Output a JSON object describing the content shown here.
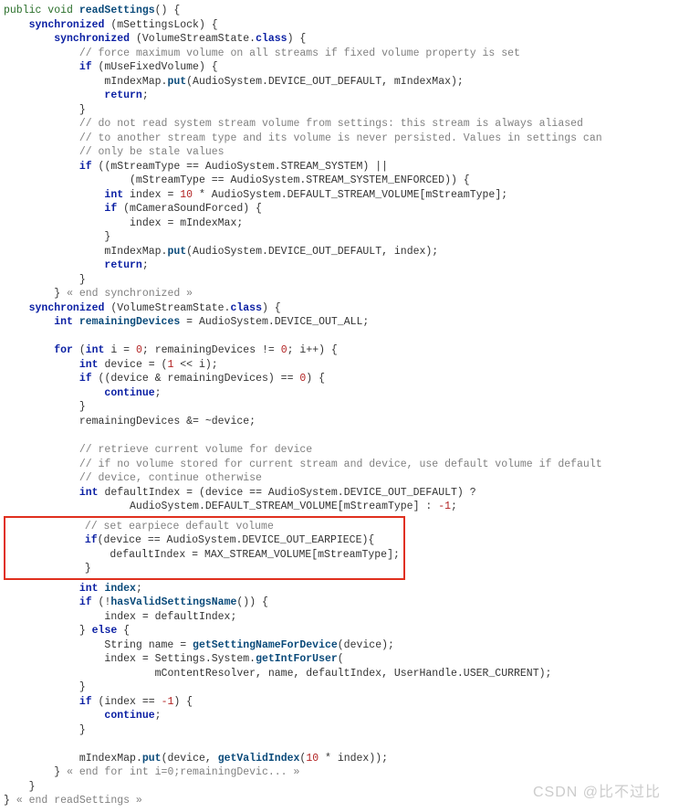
{
  "code": {
    "l1_a": "public void ",
    "l1_b": "readSettings",
    "l1_c": "() {",
    "l2_a": "synchronized",
    "l2_b": " (mSettingsLock) {",
    "l3_a": "synchronized",
    "l3_b": " (VolumeStreamState.",
    "l3_c": "class",
    "l3_d": ") {",
    "l4": "// force maximum volume on all streams if fixed volume property is set",
    "l5_a": "if",
    "l5_b": " (mUseFixedVolume) {",
    "l6_a": "mIndexMap.",
    "l6_b": "put",
    "l6_c": "(AudioSystem.DEVICE_OUT_DEFAULT, mIndexMax);",
    "l7": "return",
    "l7_b": ";",
    "l8": "}",
    "l9": "// do not read system stream volume from settings: this stream is always aliased",
    "l10": "// to another stream type and its volume is never persisted. Values in settings can",
    "l11": "// only be stale values",
    "l12_a": "if",
    "l12_b": " ((mStreamType == AudioSystem.STREAM_SYSTEM) ||",
    "l13": "(mStreamType == AudioSystem.STREAM_SYSTEM_ENFORCED)) {",
    "l14_a": "int",
    "l14_b": " index = ",
    "l14_c": "10",
    "l14_d": " * AudioSystem.DEFAULT_STREAM_VOLUME[mStreamType];",
    "l15_a": "if",
    "l15_b": " (mCameraSoundForced) {",
    "l16": "index = mIndexMax;",
    "l17": "}",
    "l18_a": "mIndexMap.",
    "l18_b": "put",
    "l18_c": "(AudioSystem.DEVICE_OUT_DEFAULT, index);",
    "l19": "return",
    "l19_b": ";",
    "l20": "}",
    "l21": "}",
    "l21_b": " « end synchronized »",
    "l22_a": "synchronized",
    "l22_b": " (VolumeStreamState.",
    "l22_c": "class",
    "l22_d": ") {",
    "l23_a": "int",
    "l23_b": " ",
    "l23_c": "remainingDevices",
    "l23_d": " = AudioSystem.DEVICE_OUT_ALL;",
    "l24_a": "for",
    "l24_b": " (",
    "l24_c": "int",
    "l24_d": " i = ",
    "l24_e": "0",
    "l24_f": "; remainingDevices != ",
    "l24_g": "0",
    "l24_h": "; i++) {",
    "l25_a": "int",
    "l25_b": " device = (",
    "l25_c": "1",
    "l25_d": " << i);",
    "l26_a": "if",
    "l26_b": " ((device & remainingDevices) == ",
    "l26_c": "0",
    "l26_d": ") {",
    "l27": "continue",
    "l27_b": ";",
    "l28": "}",
    "l29": "remainingDevices &= ~device;",
    "l30": "// retrieve current volume for device",
    "l31": "// if no volume stored for current stream and device, use default volume if default",
    "l32": "// device, continue otherwise",
    "l33_a": "int",
    "l33_b": " defaultIndex = (device == AudioSystem.DEVICE_OUT_DEFAULT) ?",
    "l34_a": "AudioSystem.DEFAULT_STREAM_VOLUME[mStreamType] : ",
    "l34_b": "-1",
    "l34_c": ";",
    "box_l1": "// set earpiece default volume",
    "box_l2_a": "if",
    "box_l2_b": "(device == AudioSystem.DEVICE_OUT_EARPIECE){",
    "box_l3": "defaultIndex = MAX_STREAM_VOLUME[mStreamType];",
    "box_l4": "}",
    "l35_a": "int",
    "l35_b": " ",
    "l35_c": "index",
    "l35_d": ";",
    "l36_a": "if",
    "l36_b": " (!",
    "l36_c": "hasValidSettingsName",
    "l36_d": "()) {",
    "l37": "index = defaultIndex;",
    "l38_a": "} ",
    "l38_b": "else",
    "l38_c": " {",
    "l39_a": "String name = ",
    "l39_b": "getSettingNameForDevice",
    "l39_c": "(device);",
    "l40_a": "index = Settings.System.",
    "l40_b": "getIntForUser",
    "l40_c": "(",
    "l41": "mContentResolver, name, defaultIndex, UserHandle.USER_CURRENT);",
    "l42": "}",
    "l43_a": "if",
    "l43_b": " (index == ",
    "l43_c": "-1",
    "l43_d": ") {",
    "l44": "continue",
    "l44_b": ";",
    "l45": "}",
    "l46_a": "mIndexMap.",
    "l46_b": "put",
    "l46_c": "(device, ",
    "l46_d": "getValidIndex",
    "l46_e": "(",
    "l46_f": "10",
    "l46_g": " * index));",
    "l47_a": "}",
    "l47_b": " « end for int i=0;remainingDevic... »",
    "l48": "}",
    "l49_a": "}",
    "l49_b": " « end readSettings »"
  },
  "watermark": "CSDN @比不过比"
}
